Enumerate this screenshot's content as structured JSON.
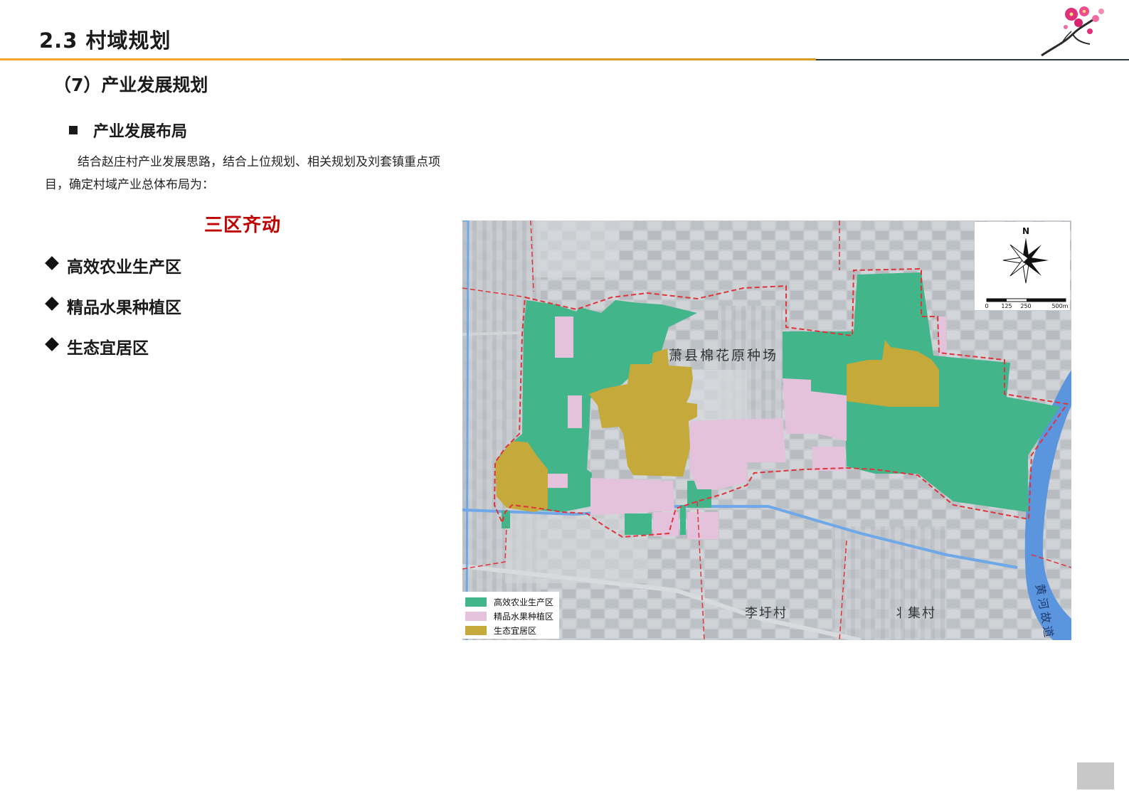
{
  "header": {
    "title": "2.3 村域规划"
  },
  "section": {
    "title": "（7）产业发展规划"
  },
  "subsection": {
    "title": "产业发展布局"
  },
  "paragraph": "结合赵庄村产业发展思路，结合上位规划、相关规划及刘套镇重点项目，确定村域产业总体布局为：",
  "highlight": "三区齐动",
  "zones": [
    {
      "label": "高效农业生产区"
    },
    {
      "label": "精品水果种植区"
    },
    {
      "label": "生态宜居区"
    }
  ],
  "map": {
    "place_labels": {
      "farm": "萧县棉花原种场",
      "li_village": "李圩村",
      "ji_village": "丬集村",
      "river": "黄河故道"
    },
    "north_label": "N",
    "scale_labels": [
      "0",
      "125",
      "250",
      "500m"
    ],
    "legend": [
      {
        "label": "高效农业生产区",
        "color": "#43b58b"
      },
      {
        "label": "精品水果种植区",
        "color": "#e4c2dc"
      },
      {
        "label": "生态宜居区",
        "color": "#c5a93a"
      }
    ],
    "colors": {
      "agriculture": "#43b58b",
      "fruit": "#e4c2dc",
      "residential": "#c5a93a",
      "boundary": "#e0333a",
      "water": "#6ea8e8"
    }
  }
}
